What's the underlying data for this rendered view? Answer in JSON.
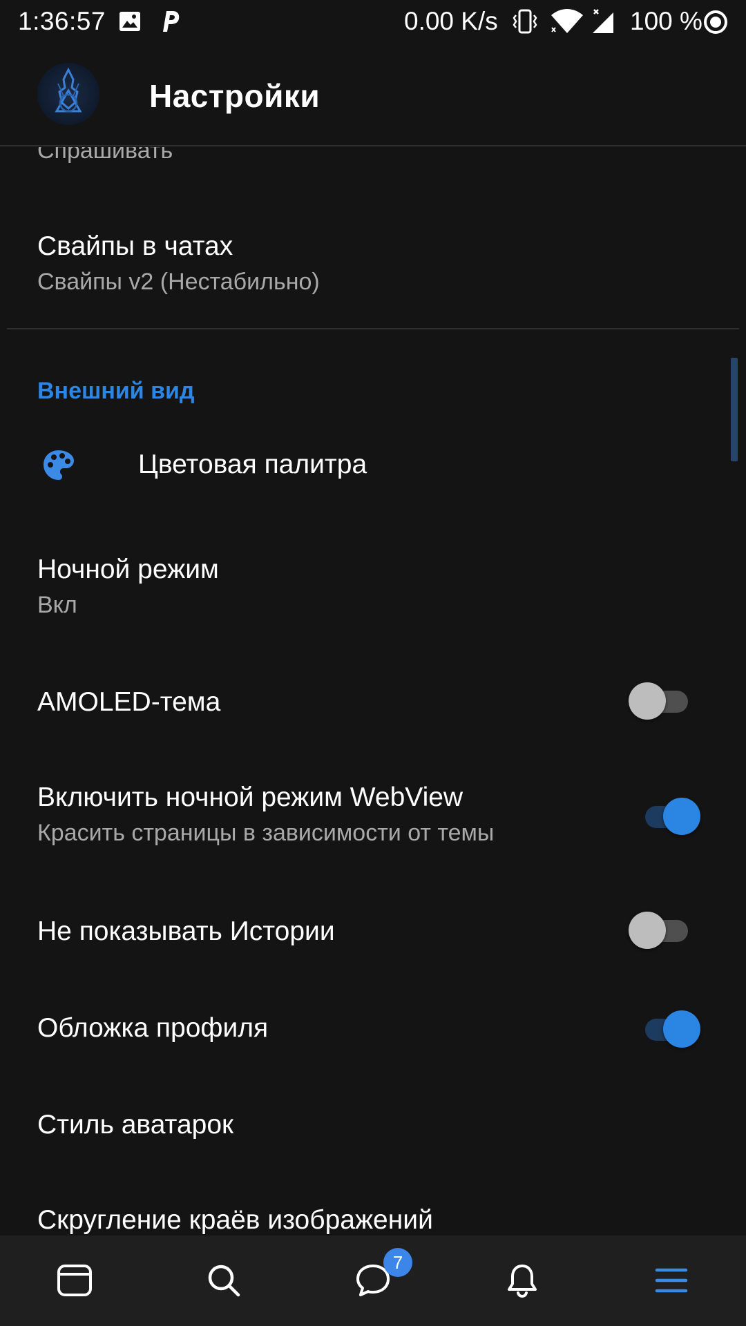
{
  "status_bar": {
    "time": "1:36:57",
    "net_speed": "0.00 K/s",
    "battery": "100 %"
  },
  "header": {
    "title": "Настройки"
  },
  "settings": {
    "partial_top_subtitle": "Спрашивать",
    "swipes": {
      "title": "Свайпы в чатах",
      "subtitle": "Свайпы v2 (Нестабильно)"
    },
    "appearance_header": "Внешний вид",
    "palette": {
      "title": "Цветовая палитра"
    },
    "night_mode": {
      "title": "Ночной режим",
      "subtitle": "Вкл"
    },
    "amoled": {
      "title": "AMOLED-тема",
      "enabled": false
    },
    "webview_night": {
      "title": "Включить ночной режим WebView",
      "subtitle": "Красить страницы в зависимости от темы",
      "enabled": true
    },
    "hide_stories": {
      "title": "Не показывать Истории",
      "enabled": false
    },
    "profile_cover": {
      "title": "Обложка профиля",
      "enabled": true
    },
    "avatar_style": {
      "title": "Стиль аватарок"
    },
    "image_rounding": {
      "title": "Скругление краёв изображений"
    }
  },
  "bottom_nav": {
    "messages_badge": "7",
    "items": [
      "feed-icon",
      "search-icon",
      "messages-icon",
      "notifications-icon",
      "menu-icon"
    ],
    "active": "menu-icon"
  },
  "colors": {
    "accent": "#2d86e3",
    "background": "#141414",
    "nav_background": "#1f1f1f"
  }
}
